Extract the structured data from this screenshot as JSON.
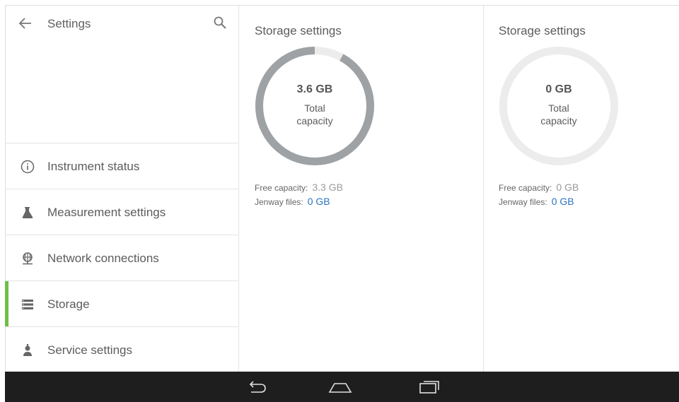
{
  "sidebar": {
    "title": "Settings",
    "items": [
      {
        "label": "Instrument status",
        "icon": "info-icon"
      },
      {
        "label": "Measurement settings",
        "icon": "flask-icon"
      },
      {
        "label": "Network connections",
        "icon": "network-icon"
      },
      {
        "label": "Storage",
        "icon": "storage-icon",
        "active": true
      },
      {
        "label": "Service settings",
        "icon": "service-icon"
      }
    ]
  },
  "storage_left": {
    "title": "Storage settings",
    "total_value": "3.6 GB",
    "total_caption": "Total capacity",
    "used_fraction": 0.92,
    "free_label": "Free capacity:",
    "free_value": "3.3 GB",
    "jenway_label": "Jenway files:",
    "jenway_value": "0 GB"
  },
  "storage_right": {
    "title": "Storage settings",
    "total_value": "0 GB",
    "total_caption": "Total capacity",
    "used_fraction": 0,
    "free_label": "Free capacity:",
    "free_value": "0 GB",
    "jenway_label": "Jenway files:",
    "jenway_value": "0 GB"
  },
  "colors": {
    "accent_active": "#6fbf45",
    "ring_used": "#9ea2a5",
    "ring_empty": "#ececec",
    "link_blue": "#2d73c0",
    "system_bar": "#1e1e1e"
  },
  "system_bar": {
    "buttons": [
      "back-icon",
      "home-icon",
      "recent-apps-icon"
    ]
  }
}
